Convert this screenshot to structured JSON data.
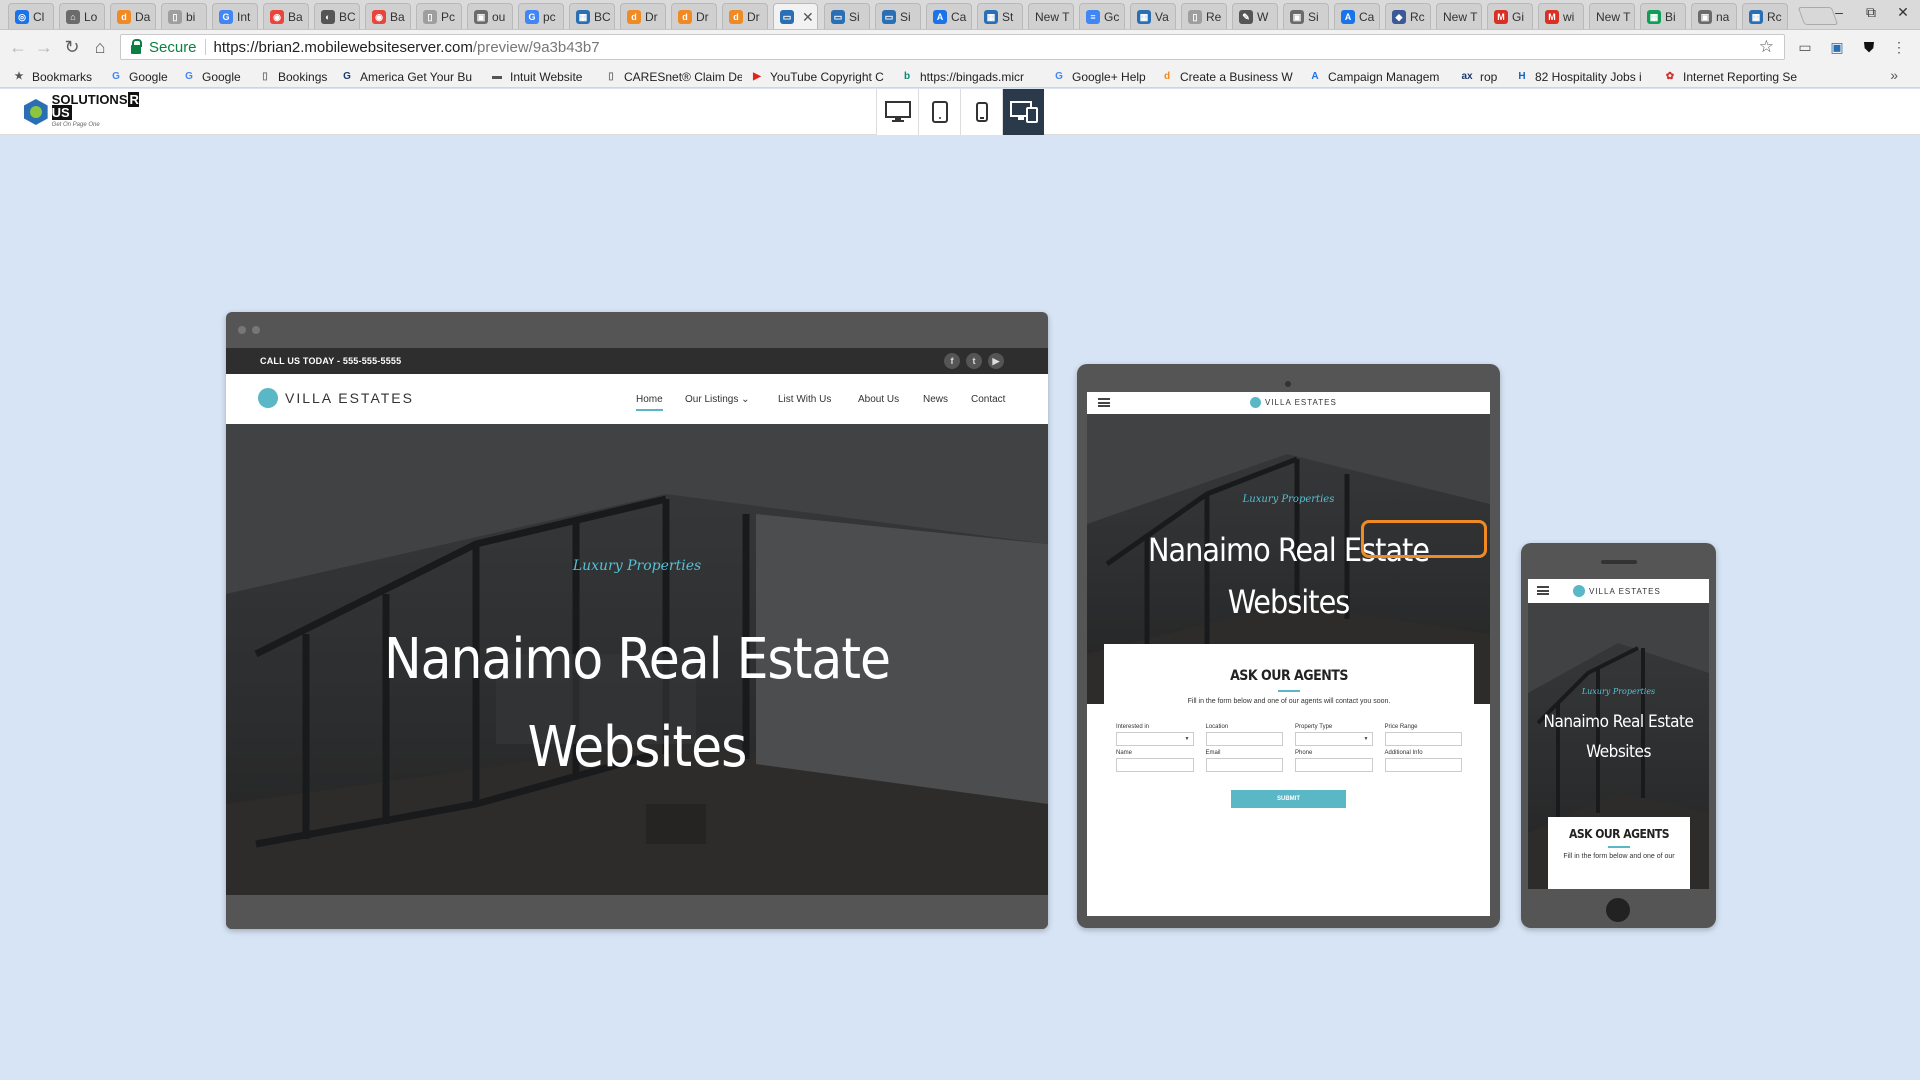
{
  "browser": {
    "tabs": [
      {
        "label": "Cl",
        "fav_color": "#1a73e8",
        "fav_glyph": "◎"
      },
      {
        "label": "Lo",
        "fav_color": "#6b6b6b",
        "fav_glyph": "⌂"
      },
      {
        "label": "Da",
        "fav_color": "#f08a24",
        "fav_glyph": "d"
      },
      {
        "label": "bi",
        "fav_color": "#9e9e9e",
        "fav_glyph": "▯"
      },
      {
        "label": "Int",
        "fav_color": "#4285f4",
        "fav_glyph": "G"
      },
      {
        "label": "Ba",
        "fav_color": "#e8453c",
        "fav_glyph": "◉"
      },
      {
        "label": "BC",
        "fav_color": "#555555",
        "fav_glyph": "◐"
      },
      {
        "label": "Ba",
        "fav_color": "#e8453c",
        "fav_glyph": "◉"
      },
      {
        "label": "Pc",
        "fav_color": "#9e9e9e",
        "fav_glyph": "▯"
      },
      {
        "label": "ou",
        "fav_color": "#6b6b6b",
        "fav_glyph": "▣"
      },
      {
        "label": "pc",
        "fav_color": "#4285f4",
        "fav_glyph": "G"
      },
      {
        "label": "BC",
        "fav_color": "#2a6fb3",
        "fav_glyph": "▦"
      },
      {
        "label": "Dr",
        "fav_color": "#f08a24",
        "fav_glyph": "d"
      },
      {
        "label": "Dr",
        "fav_color": "#f08a24",
        "fav_glyph": "d"
      },
      {
        "label": "Dr",
        "fav_color": "#f08a24",
        "fav_glyph": "d"
      },
      {
        "label": "",
        "fav_color": "#2a6fb3",
        "fav_glyph": "▭",
        "active": true
      },
      {
        "label": "Si",
        "fav_color": "#2a6fb3",
        "fav_glyph": "▭"
      },
      {
        "label": "Si",
        "fav_color": "#2a6fb3",
        "fav_glyph": "▭"
      },
      {
        "label": "Ca",
        "fav_color": "#1a73e8",
        "fav_glyph": "A"
      },
      {
        "label": "St",
        "fav_color": "#2a6fb3",
        "fav_glyph": "▦"
      },
      {
        "label": "New T",
        "fav_color": "",
        "fav_glyph": ""
      },
      {
        "label": "Gc",
        "fav_color": "#4285f4",
        "fav_glyph": "≡"
      },
      {
        "label": "Va",
        "fav_color": "#2a6fb3",
        "fav_glyph": "▦"
      },
      {
        "label": "Re",
        "fav_color": "#9e9e9e",
        "fav_glyph": "▯"
      },
      {
        "label": "W",
        "fav_color": "#555555",
        "fav_glyph": "✎"
      },
      {
        "label": "Si",
        "fav_color": "#6b6b6b",
        "fav_glyph": "▣"
      },
      {
        "label": "Ca",
        "fav_color": "#1a73e8",
        "fav_glyph": "A"
      },
      {
        "label": "Rc",
        "fav_color": "#3b5998",
        "fav_glyph": "◆"
      },
      {
        "label": "New T",
        "fav_color": "",
        "fav_glyph": ""
      },
      {
        "label": "Gi",
        "fav_color": "#d93025",
        "fav_glyph": "M"
      },
      {
        "label": "wi",
        "fav_color": "#d93025",
        "fav_glyph": "M"
      },
      {
        "label": "New T",
        "fav_color": "",
        "fav_glyph": ""
      },
      {
        "label": "Bi",
        "fav_color": "#0f9d58",
        "fav_glyph": "▦"
      },
      {
        "label": "na",
        "fav_color": "#6b6b6b",
        "fav_glyph": "▣"
      },
      {
        "label": "Rc",
        "fav_color": "#2a6fb3",
        "fav_glyph": "▦"
      }
    ],
    "window_controls": [
      "–",
      "⧉",
      "✕"
    ],
    "address": {
      "secure_label": "Secure",
      "url_host": "https://brian2.mobilewebsiteserver.com",
      "url_path": "/preview/9a3b43b7"
    },
    "bookmarks": [
      {
        "label": "Bookmarks",
        "glyph": "★",
        "color": "#555555"
      },
      {
        "label": "Google",
        "glyph": "G",
        "color": "#4285f4"
      },
      {
        "label": "Google",
        "glyph": "G",
        "color": "#4285f4"
      },
      {
        "label": "Bookings",
        "glyph": "▯",
        "color": "#777777"
      },
      {
        "label": "America Get Your Bu",
        "glyph": "G",
        "color": "#1b3a6b"
      },
      {
        "label": "Intuit Website",
        "glyph": "▬",
        "color": "#555555"
      },
      {
        "label": "CARESnet® Claim De",
        "glyph": "▯",
        "color": "#777777"
      },
      {
        "label": "YouTube Copyright C",
        "glyph": "▶",
        "color": "#e62117"
      },
      {
        "label": "https://bingads.micr",
        "glyph": "b",
        "color": "#00897b"
      },
      {
        "label": "Google+ Help",
        "glyph": "G",
        "color": "#4285f4"
      },
      {
        "label": "Create a Business W",
        "glyph": "d",
        "color": "#f08a24"
      },
      {
        "label": "Campaign Managem",
        "glyph": "A",
        "color": "#1a73e8"
      },
      {
        "label": "rop",
        "glyph": "ax",
        "color": "#1b3a6b"
      },
      {
        "label": "82 Hospitality Jobs i",
        "glyph": "H",
        "color": "#1565c0"
      },
      {
        "label": "Internet Reporting Se",
        "glyph": "✿",
        "color": "#d32f2f"
      }
    ],
    "bookmarks_more": "»"
  },
  "preview": {
    "logo": {
      "name": "SOLUTIONS",
      "suffix": "R US",
      "tagline": "Get On Page One"
    },
    "devices": [
      {
        "name": "desktop"
      },
      {
        "name": "tablet"
      },
      {
        "name": "phone"
      },
      {
        "name": "all-devices",
        "active": true
      }
    ]
  },
  "site": {
    "call_text": "CALL US TODAY - 555-555-5555",
    "social": [
      "f",
      "t",
      "▶"
    ],
    "brand": "VILLA ESTATES",
    "nav": [
      "Home",
      "Our Listings",
      "List With Us",
      "About Us",
      "News",
      "Contact"
    ],
    "nav_dropdown_caret": "⌄",
    "tagline": "Luxury Properties",
    "hero_line1": "Nanaimo Real Estate",
    "hero_line2": "Websites",
    "ask_title": "ASK OUR AGENTS",
    "ask_sub": "Fill in the form below and one of our agents will contact you soon.",
    "ask_sub_phone": "Fill in the form below and one of our",
    "fields": [
      "Interested in",
      "Location",
      "Property Type",
      "Price Range",
      "Name",
      "Email",
      "Phone",
      "Additional Info"
    ],
    "submit": "SUBMIT"
  },
  "colors": {
    "accent": "#5ab7c6",
    "highlight": "#f08a24",
    "page_bg": "#d6e4f5"
  }
}
